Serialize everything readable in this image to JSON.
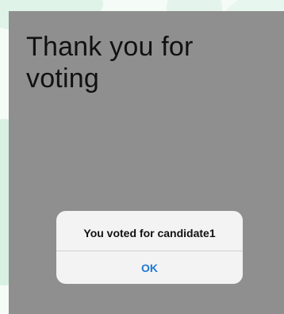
{
  "screen": {
    "title": "Thank you for voting"
  },
  "alert": {
    "message": "You voted for candidate1",
    "ok_label": "OK"
  },
  "colors": {
    "overlay": "#8f8f8f",
    "alert_background": "#f3f3f3",
    "button_text": "#1f78d4",
    "title_text": "#111111",
    "background_tint": "#dff3e8"
  }
}
